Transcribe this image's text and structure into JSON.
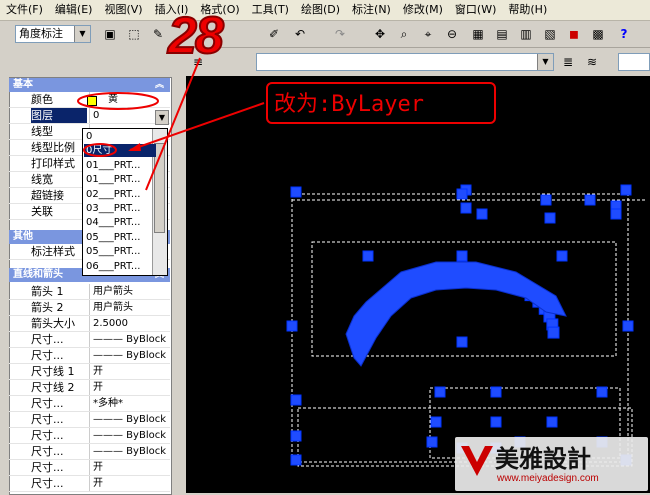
{
  "menu": [
    "文件(F)",
    "编辑(E)",
    "视图(V)",
    "插入(I)",
    "格式(O)",
    "工具(T)",
    "绘图(D)",
    "标注(N)",
    "修改(M)",
    "窗口(W)",
    "帮助(H)"
  ],
  "toolbar": {
    "dim_style_combo": "角度标注"
  },
  "properties": {
    "sections": {
      "basic": "基本",
      "other": "其他",
      "lines_arrows": "直线和箭头"
    },
    "basic_rows": [
      {
        "label": "颜色",
        "value": "黄"
      },
      {
        "label": "图层",
        "value": "0"
      },
      {
        "label": "线型",
        "value": ""
      },
      {
        "label": "线型比例",
        "value": ""
      },
      {
        "label": "打印样式",
        "value": ""
      },
      {
        "label": "线宽",
        "value": ""
      },
      {
        "label": "超链接",
        "value": ""
      },
      {
        "label": "关联",
        "value": ""
      }
    ],
    "other_rows": [
      {
        "label": "标注样式",
        "value": ""
      }
    ],
    "line_rows": [
      {
        "label": "箭头 1",
        "value": "用户箭头"
      },
      {
        "label": "箭头 2",
        "value": "用户箭头"
      },
      {
        "label": "箭头大小",
        "value": "2.5000"
      },
      {
        "label": "尺寸...",
        "value": "——— ByBlock"
      },
      {
        "label": "尺寸...",
        "value": "——— ByBlock"
      },
      {
        "label": "尺寸线 1",
        "value": "开"
      },
      {
        "label": "尺寸线 2",
        "value": "开"
      },
      {
        "label": "尺寸...",
        "value": "*多种*"
      },
      {
        "label": "尺寸...",
        "value": "——— ByBlock"
      },
      {
        "label": "尺寸...",
        "value": "——— ByBlock"
      },
      {
        "label": "尺寸...",
        "value": "——— ByBlock"
      },
      {
        "label": "尺寸...",
        "value": "开"
      },
      {
        "label": "尺寸...",
        "value": "开"
      }
    ],
    "layer_dropdown": [
      "0",
      "0尺寸",
      "01___PRT...",
      "01___PRT...",
      "02___PRT...",
      "03___PRT...",
      "04___PRT...",
      "05___PRT...",
      "05___PRT...",
      "06___PRT..."
    ]
  },
  "annotation": {
    "step_number": "28",
    "instruction": "改为:ByLayer"
  },
  "watermark": {
    "brand": "美雅設計",
    "url": "www.meiyadesign.com"
  },
  "colors": {
    "accent_red": "#e00000",
    "drawing_blue": "#1f4cff",
    "section_header": "#7a96df",
    "selection": "#0a246a"
  }
}
